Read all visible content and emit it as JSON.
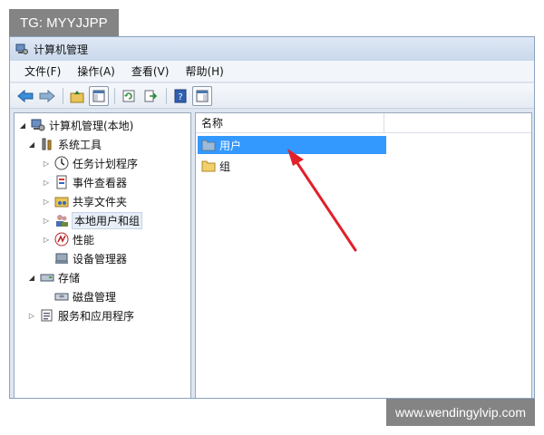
{
  "watermarks": {
    "top_left": "TG: MYYJJPP",
    "bottom_right": "www.wendingylvip.com"
  },
  "window": {
    "title": "计算机管理"
  },
  "menu": [
    {
      "label": "文件(F)"
    },
    {
      "label": "操作(A)"
    },
    {
      "label": "查看(V)"
    },
    {
      "label": "帮助(H)"
    }
  ],
  "tree": {
    "root": "计算机管理(本地)",
    "system_tools": "系统工具",
    "task_scheduler": "任务计划程序",
    "event_viewer": "事件查看器",
    "shared_folders": "共享文件夹",
    "local_users_groups": "本地用户和组",
    "performance": "性能",
    "device_manager": "设备管理器",
    "storage": "存储",
    "disk_management": "磁盘管理",
    "services_apps": "服务和应用程序"
  },
  "list": {
    "column_name": "名称",
    "items": [
      {
        "label": "用户"
      },
      {
        "label": "组"
      }
    ]
  },
  "colors": {
    "selection": "#3399ff",
    "arrow": "#e0202a"
  }
}
